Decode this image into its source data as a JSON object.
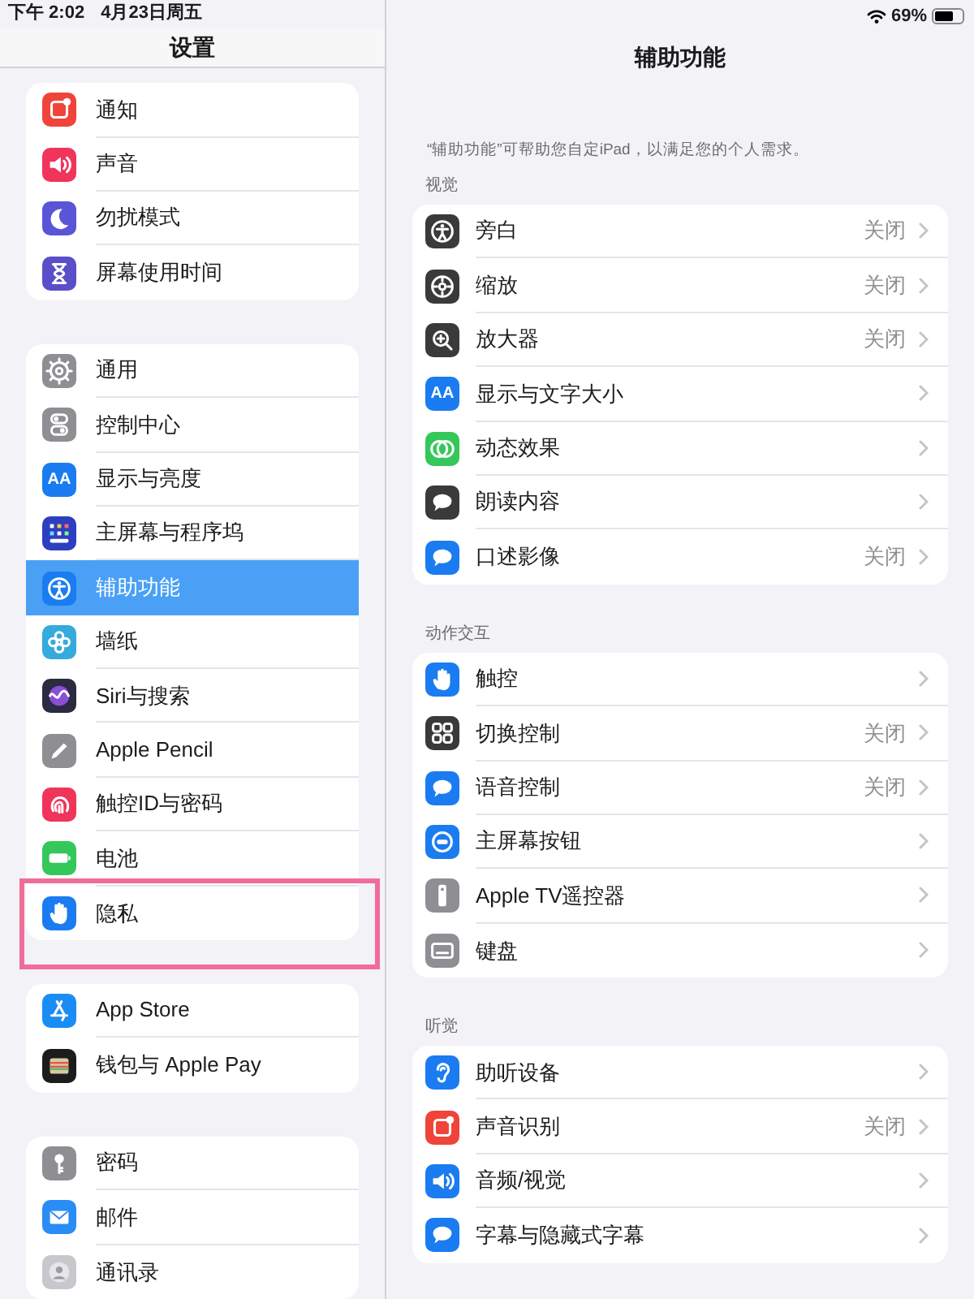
{
  "status_bar": {
    "time": "下午 2:02",
    "date": "4月23日周五",
    "battery_text": "69%"
  },
  "sidebar": {
    "title": "设置",
    "groups": [
      [
        {
          "label": "通知",
          "kind": "badge-square",
          "color": "#f0443a",
          "selected": false,
          "highlighted": false
        },
        {
          "label": "声音",
          "kind": "speaker",
          "color": "#f0345a",
          "selected": false,
          "highlighted": false
        },
        {
          "label": "勿扰模式",
          "kind": "moon",
          "color": "#5a55d6",
          "selected": false,
          "highlighted": false
        },
        {
          "label": "屏幕使用时间",
          "kind": "hourglass",
          "color": "#5a4fc8",
          "selected": false,
          "highlighted": false
        }
      ],
      [
        {
          "label": "通用",
          "kind": "gear",
          "color": "#8e8e93",
          "selected": false,
          "highlighted": false
        },
        {
          "label": "控制中心",
          "kind": "toggles",
          "color": "#8e8e93",
          "selected": false,
          "highlighted": false
        },
        {
          "label": "显示与亮度",
          "kind": "text",
          "icon_text": "AA",
          "color": "#1a7cf0",
          "selected": false,
          "highlighted": false
        },
        {
          "label": "主屏幕与程序坞",
          "kind": "dot-grid",
          "color": "#2d3fc0",
          "selected": false,
          "highlighted": false
        },
        {
          "label": "辅助功能",
          "kind": "person-circle",
          "color": "#1a7cf0",
          "selected": true,
          "highlighted": false
        },
        {
          "label": "墙纸",
          "kind": "flower",
          "color": "#35aadc",
          "selected": false,
          "highlighted": false
        },
        {
          "label": "Siri与搜索",
          "kind": "orb",
          "color": "#2a2a40",
          "selected": false,
          "highlighted": false
        },
        {
          "label": "Apple Pencil",
          "kind": "pencil",
          "color": "#8e8e93",
          "selected": false,
          "highlighted": false
        },
        {
          "label": "触控ID与密码",
          "kind": "fingerprint",
          "color": "#f0345a",
          "selected": false,
          "highlighted": false
        },
        {
          "label": "电池",
          "kind": "battery",
          "color": "#34c759",
          "selected": false,
          "highlighted": false
        },
        {
          "label": "隐私",
          "kind": "hand",
          "color": "#1a7cf0",
          "selected": false,
          "highlighted": true
        }
      ],
      [
        {
          "label": "App Store",
          "kind": "store",
          "color": "#1a8cf5",
          "selected": false,
          "highlighted": false
        },
        {
          "label": "钱包与 Apple Pay",
          "kind": "wallet",
          "color": "#1c1c1e",
          "selected": false,
          "highlighted": false
        }
      ],
      [
        {
          "label": "密码",
          "kind": "key",
          "color": "#8e8e93",
          "selected": false,
          "highlighted": false
        },
        {
          "label": "邮件",
          "kind": "envelope",
          "color": "#2a8cf5",
          "selected": false,
          "highlighted": false
        },
        {
          "label": "通讯录",
          "kind": "contact",
          "color": "#c8c8cc",
          "selected": false,
          "highlighted": false
        }
      ]
    ]
  },
  "detail": {
    "title": "辅助功能",
    "description": "“辅助功能”可帮助您自定iPad，以满足您的个人需求。",
    "sections": [
      {
        "header": "视觉",
        "rows": [
          {
            "label": "旁白",
            "kind": "person-circle",
            "color": "#3a3a3c",
            "value": "关闭"
          },
          {
            "label": "缩放",
            "kind": "target",
            "color": "#3a3a3c",
            "value": "关闭"
          },
          {
            "label": "放大器",
            "kind": "magnifier",
            "color": "#3a3a3c",
            "value": "关闭"
          },
          {
            "label": "显示与文字大小",
            "kind": "text",
            "icon_text": "AA",
            "color": "#1a7cf0"
          },
          {
            "label": "动态效果",
            "kind": "circles",
            "color": "#34c759"
          },
          {
            "label": "朗读内容",
            "kind": "bubble",
            "color": "#3a3a3c"
          },
          {
            "label": "口述影像",
            "kind": "bubble",
            "color": "#1a7cf0",
            "value": "关闭"
          }
        ]
      },
      {
        "header": "动作交互",
        "rows": [
          {
            "label": "触控",
            "kind": "hand",
            "color": "#1a7cf0"
          },
          {
            "label": "切换控制",
            "kind": "four-squares",
            "color": "#3a3a3c",
            "value": "关闭"
          },
          {
            "label": "语音控制",
            "kind": "bubble",
            "color": "#1a7cf0",
            "value": "关闭"
          },
          {
            "label": "主屏幕按钮",
            "kind": "ring",
            "color": "#1a7cf0"
          },
          {
            "label": "Apple TV遥控器",
            "kind": "remote",
            "color": "#8e8e93"
          },
          {
            "label": "键盘",
            "kind": "keyboard",
            "color": "#8e8e93"
          }
        ]
      },
      {
        "header": "听觉",
        "rows": [
          {
            "label": "助听设备",
            "kind": "ear",
            "color": "#1a7cf0"
          },
          {
            "label": "声音识别",
            "kind": "badge-square",
            "color": "#f0443a",
            "value": "关闭"
          },
          {
            "label": "音频/视觉",
            "kind": "speaker",
            "color": "#1a7cf0"
          },
          {
            "label": "字幕与隐藏式字幕",
            "kind": "bubble",
            "color": "#1a7cf0"
          }
        ]
      }
    ]
  }
}
